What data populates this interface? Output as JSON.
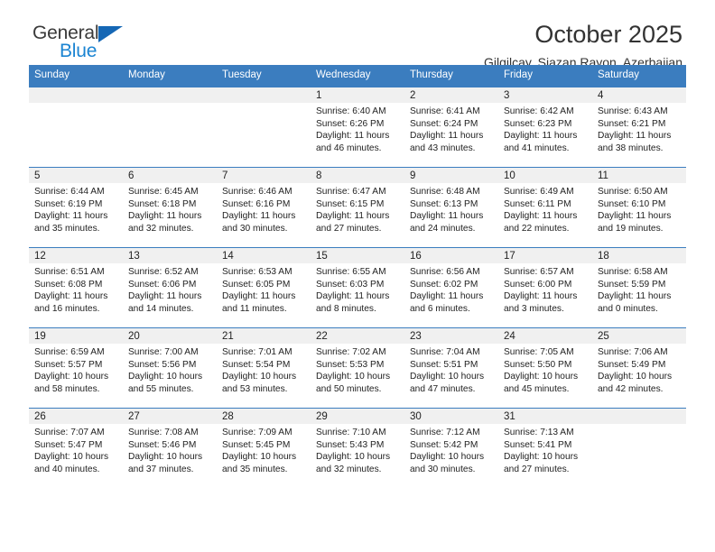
{
  "brand": {
    "name_part1": "General",
    "name_part2": "Blue",
    "triangle_icon": "triangle-icon",
    "accent_color": "#1b84d2"
  },
  "header": {
    "title": "October 2025",
    "subtitle": "Gilgilcay, Siazan Rayon, Azerbaijan"
  },
  "calendar": {
    "header_bg_color": "#3b7dbf",
    "day_band_color": "#f0f0f0",
    "weekdays": [
      "Sunday",
      "Monday",
      "Tuesday",
      "Wednesday",
      "Thursday",
      "Friday",
      "Saturday"
    ],
    "weeks": [
      [
        {
          "date": "",
          "sunrise": "",
          "sunset": "",
          "daylight": ""
        },
        {
          "date": "",
          "sunrise": "",
          "sunset": "",
          "daylight": ""
        },
        {
          "date": "",
          "sunrise": "",
          "sunset": "",
          "daylight": ""
        },
        {
          "date": "1",
          "sunrise": "Sunrise: 6:40 AM",
          "sunset": "Sunset: 6:26 PM",
          "daylight": "Daylight: 11 hours and 46 minutes."
        },
        {
          "date": "2",
          "sunrise": "Sunrise: 6:41 AM",
          "sunset": "Sunset: 6:24 PM",
          "daylight": "Daylight: 11 hours and 43 minutes."
        },
        {
          "date": "3",
          "sunrise": "Sunrise: 6:42 AM",
          "sunset": "Sunset: 6:23 PM",
          "daylight": "Daylight: 11 hours and 41 minutes."
        },
        {
          "date": "4",
          "sunrise": "Sunrise: 6:43 AM",
          "sunset": "Sunset: 6:21 PM",
          "daylight": "Daylight: 11 hours and 38 minutes."
        }
      ],
      [
        {
          "date": "5",
          "sunrise": "Sunrise: 6:44 AM",
          "sunset": "Sunset: 6:19 PM",
          "daylight": "Daylight: 11 hours and 35 minutes."
        },
        {
          "date": "6",
          "sunrise": "Sunrise: 6:45 AM",
          "sunset": "Sunset: 6:18 PM",
          "daylight": "Daylight: 11 hours and 32 minutes."
        },
        {
          "date": "7",
          "sunrise": "Sunrise: 6:46 AM",
          "sunset": "Sunset: 6:16 PM",
          "daylight": "Daylight: 11 hours and 30 minutes."
        },
        {
          "date": "8",
          "sunrise": "Sunrise: 6:47 AM",
          "sunset": "Sunset: 6:15 PM",
          "daylight": "Daylight: 11 hours and 27 minutes."
        },
        {
          "date": "9",
          "sunrise": "Sunrise: 6:48 AM",
          "sunset": "Sunset: 6:13 PM",
          "daylight": "Daylight: 11 hours and 24 minutes."
        },
        {
          "date": "10",
          "sunrise": "Sunrise: 6:49 AM",
          "sunset": "Sunset: 6:11 PM",
          "daylight": "Daylight: 11 hours and 22 minutes."
        },
        {
          "date": "11",
          "sunrise": "Sunrise: 6:50 AM",
          "sunset": "Sunset: 6:10 PM",
          "daylight": "Daylight: 11 hours and 19 minutes."
        }
      ],
      [
        {
          "date": "12",
          "sunrise": "Sunrise: 6:51 AM",
          "sunset": "Sunset: 6:08 PM",
          "daylight": "Daylight: 11 hours and 16 minutes."
        },
        {
          "date": "13",
          "sunrise": "Sunrise: 6:52 AM",
          "sunset": "Sunset: 6:06 PM",
          "daylight": "Daylight: 11 hours and 14 minutes."
        },
        {
          "date": "14",
          "sunrise": "Sunrise: 6:53 AM",
          "sunset": "Sunset: 6:05 PM",
          "daylight": "Daylight: 11 hours and 11 minutes."
        },
        {
          "date": "15",
          "sunrise": "Sunrise: 6:55 AM",
          "sunset": "Sunset: 6:03 PM",
          "daylight": "Daylight: 11 hours and 8 minutes."
        },
        {
          "date": "16",
          "sunrise": "Sunrise: 6:56 AM",
          "sunset": "Sunset: 6:02 PM",
          "daylight": "Daylight: 11 hours and 6 minutes."
        },
        {
          "date": "17",
          "sunrise": "Sunrise: 6:57 AM",
          "sunset": "Sunset: 6:00 PM",
          "daylight": "Daylight: 11 hours and 3 minutes."
        },
        {
          "date": "18",
          "sunrise": "Sunrise: 6:58 AM",
          "sunset": "Sunset: 5:59 PM",
          "daylight": "Daylight: 11 hours and 0 minutes."
        }
      ],
      [
        {
          "date": "19",
          "sunrise": "Sunrise: 6:59 AM",
          "sunset": "Sunset: 5:57 PM",
          "daylight": "Daylight: 10 hours and 58 minutes."
        },
        {
          "date": "20",
          "sunrise": "Sunrise: 7:00 AM",
          "sunset": "Sunset: 5:56 PM",
          "daylight": "Daylight: 10 hours and 55 minutes."
        },
        {
          "date": "21",
          "sunrise": "Sunrise: 7:01 AM",
          "sunset": "Sunset: 5:54 PM",
          "daylight": "Daylight: 10 hours and 53 minutes."
        },
        {
          "date": "22",
          "sunrise": "Sunrise: 7:02 AM",
          "sunset": "Sunset: 5:53 PM",
          "daylight": "Daylight: 10 hours and 50 minutes."
        },
        {
          "date": "23",
          "sunrise": "Sunrise: 7:04 AM",
          "sunset": "Sunset: 5:51 PM",
          "daylight": "Daylight: 10 hours and 47 minutes."
        },
        {
          "date": "24",
          "sunrise": "Sunrise: 7:05 AM",
          "sunset": "Sunset: 5:50 PM",
          "daylight": "Daylight: 10 hours and 45 minutes."
        },
        {
          "date": "25",
          "sunrise": "Sunrise: 7:06 AM",
          "sunset": "Sunset: 5:49 PM",
          "daylight": "Daylight: 10 hours and 42 minutes."
        }
      ],
      [
        {
          "date": "26",
          "sunrise": "Sunrise: 7:07 AM",
          "sunset": "Sunset: 5:47 PM",
          "daylight": "Daylight: 10 hours and 40 minutes."
        },
        {
          "date": "27",
          "sunrise": "Sunrise: 7:08 AM",
          "sunset": "Sunset: 5:46 PM",
          "daylight": "Daylight: 10 hours and 37 minutes."
        },
        {
          "date": "28",
          "sunrise": "Sunrise: 7:09 AM",
          "sunset": "Sunset: 5:45 PM",
          "daylight": "Daylight: 10 hours and 35 minutes."
        },
        {
          "date": "29",
          "sunrise": "Sunrise: 7:10 AM",
          "sunset": "Sunset: 5:43 PM",
          "daylight": "Daylight: 10 hours and 32 minutes."
        },
        {
          "date": "30",
          "sunrise": "Sunrise: 7:12 AM",
          "sunset": "Sunset: 5:42 PM",
          "daylight": "Daylight: 10 hours and 30 minutes."
        },
        {
          "date": "31",
          "sunrise": "Sunrise: 7:13 AM",
          "sunset": "Sunset: 5:41 PM",
          "daylight": "Daylight: 10 hours and 27 minutes."
        },
        {
          "date": "",
          "sunrise": "",
          "sunset": "",
          "daylight": ""
        }
      ]
    ]
  }
}
